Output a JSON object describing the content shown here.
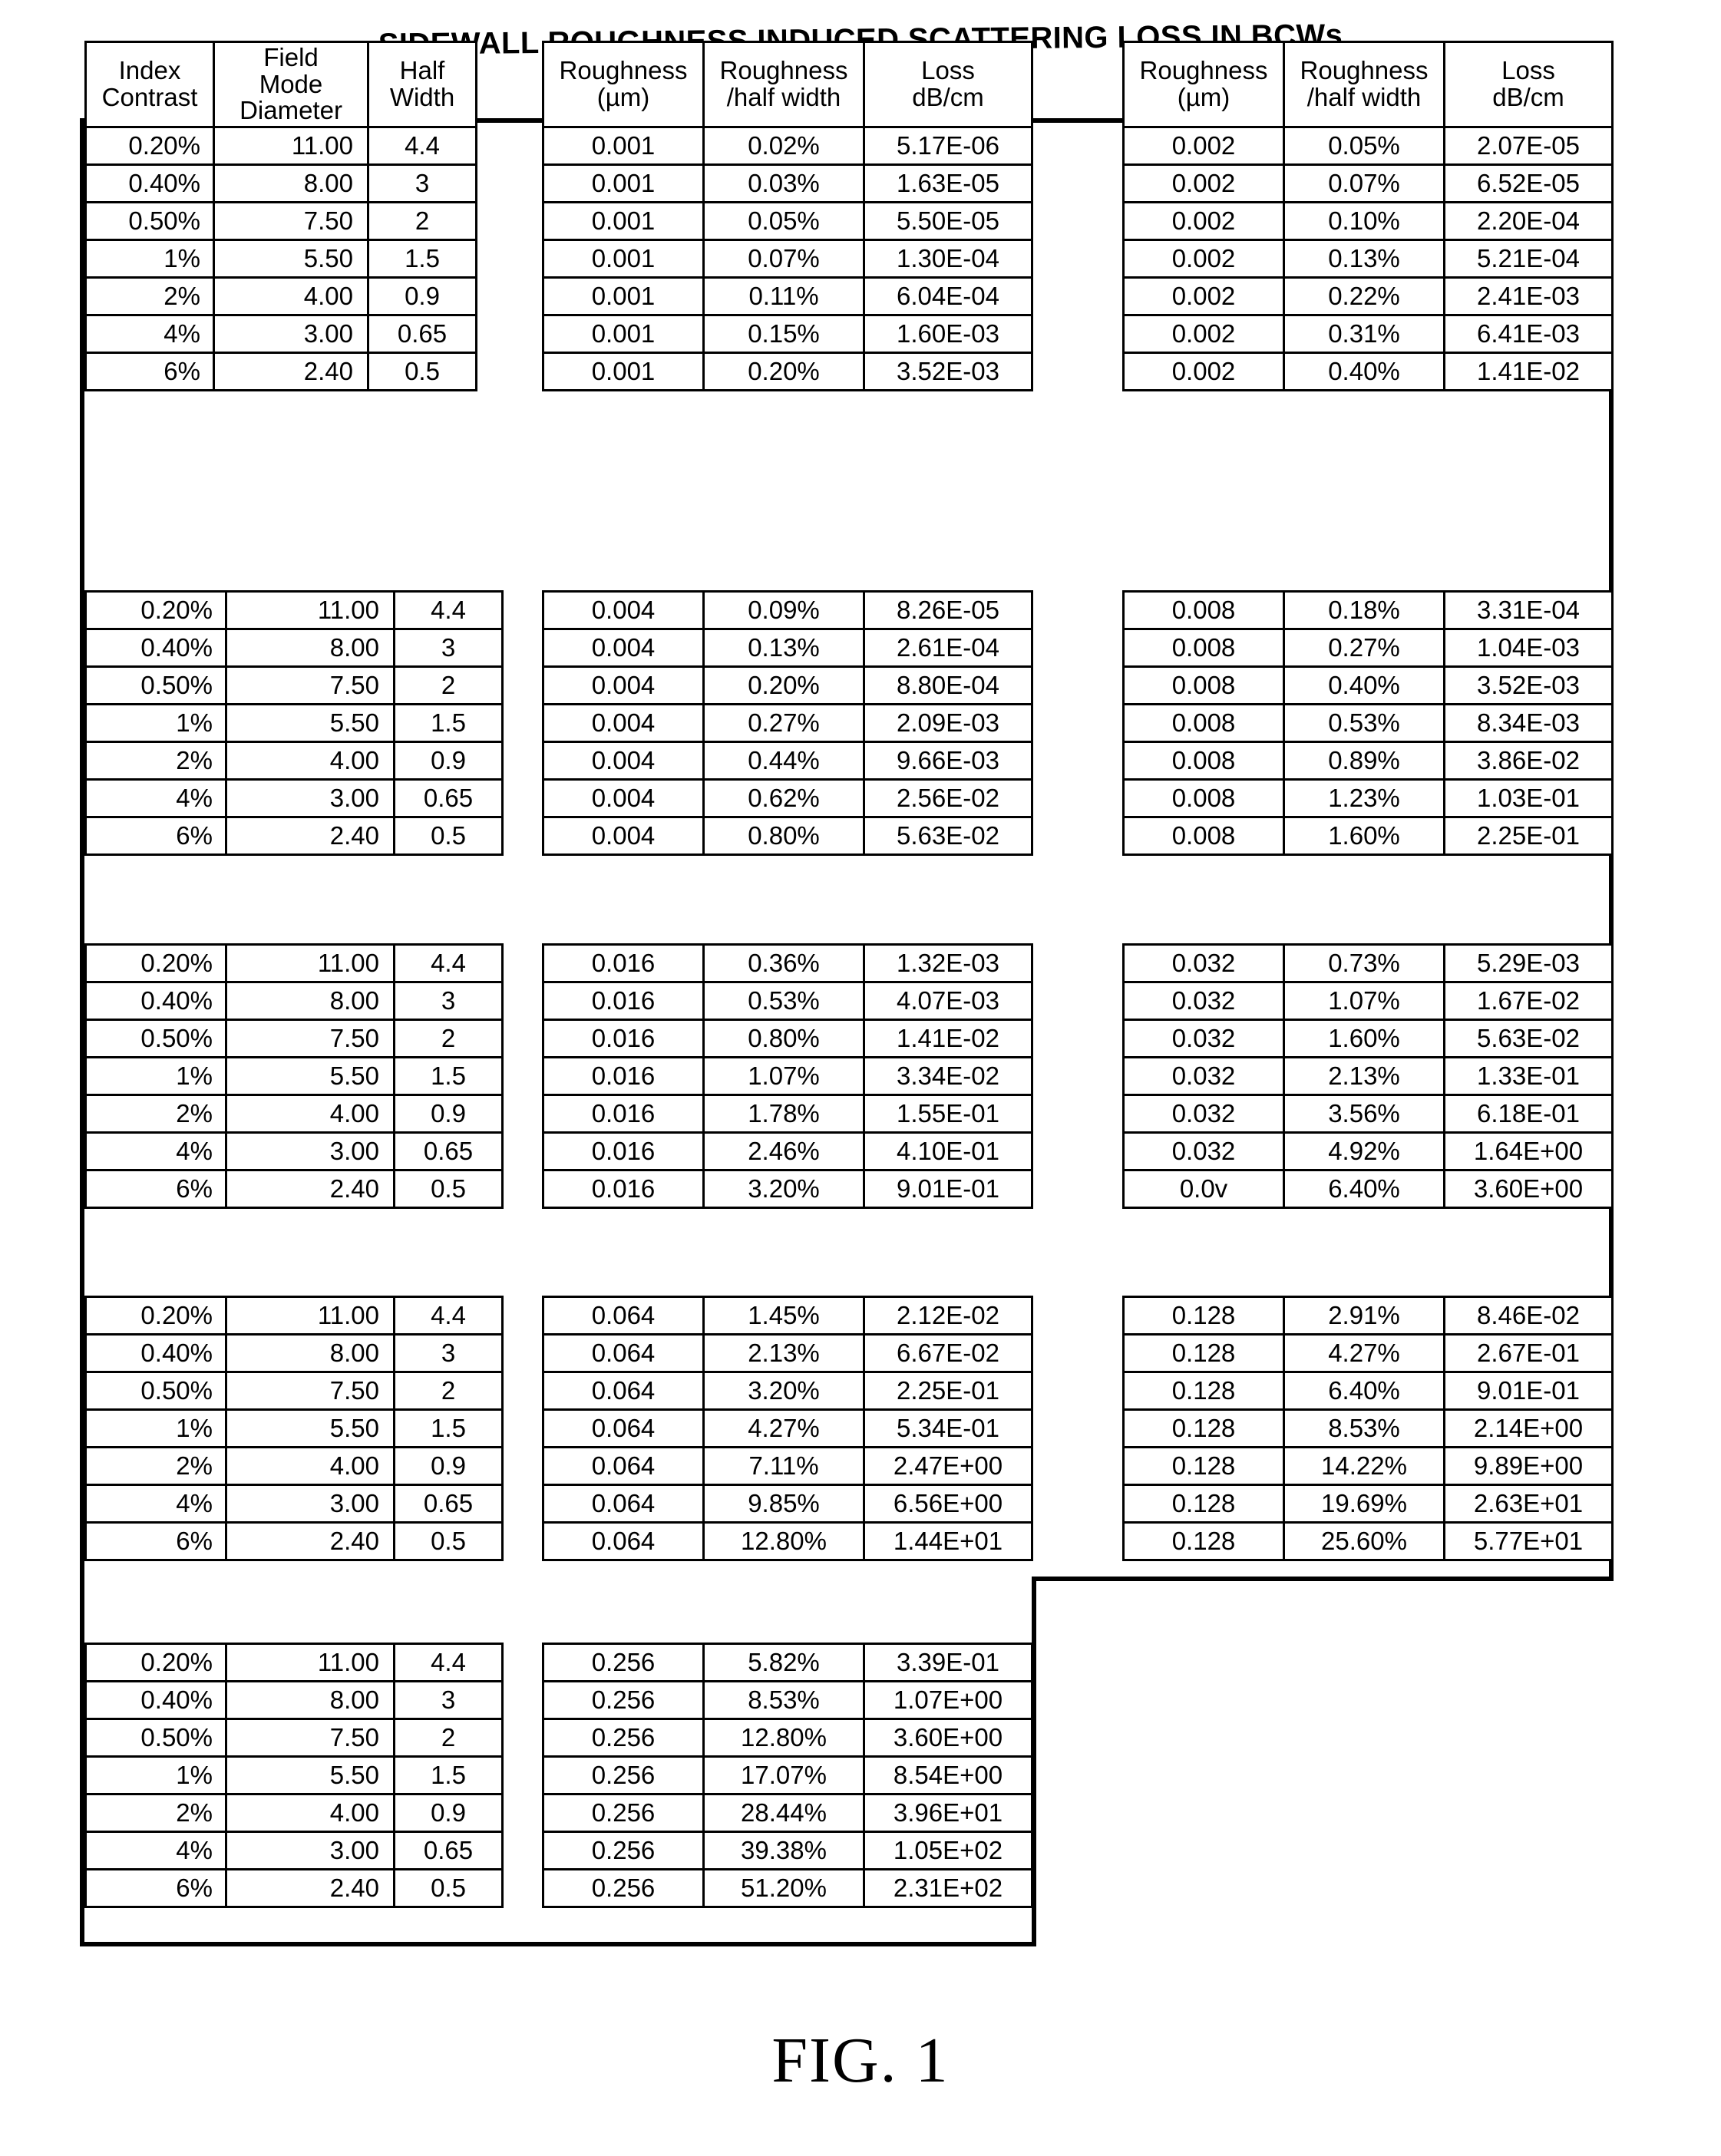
{
  "title": "SIDEWALL ROUGHNESS INDUCED SCATTERING LOSS IN BCWs",
  "figure_caption": "FIG. 1",
  "headers": {
    "index_contrast_l1": "Index",
    "index_contrast_l2": "Contrast",
    "field_mode_l1": "Field",
    "field_mode_l2": "Mode",
    "field_mode_l3": "Diameter",
    "half_width_l1": "Half",
    "half_width_l2": "Width",
    "roughness_l1": "Roughness",
    "roughness_l2": "(µm)",
    "roughness_ratio_l1": "Roughness",
    "roughness_ratio_l2": "/half width",
    "loss_l1": "Loss",
    "loss_l2": "dB/cm"
  },
  "waveguide_rows": [
    {
      "index_contrast": "0.20%",
      "field_mode_diameter": "11.00",
      "half_width": "4.4"
    },
    {
      "index_contrast": "0.40%",
      "field_mode_diameter": "8.00",
      "half_width": "3"
    },
    {
      "index_contrast": "0.50%",
      "field_mode_diameter": "7.50",
      "half_width": "2"
    },
    {
      "index_contrast": "1%",
      "field_mode_diameter": "5.50",
      "half_width": "1.5"
    },
    {
      "index_contrast": "2%",
      "field_mode_diameter": "4.00",
      "half_width": "0.9"
    },
    {
      "index_contrast": "4%",
      "field_mode_diameter": "3.00",
      "half_width": "0.65"
    },
    {
      "index_contrast": "6%",
      "field_mode_diameter": "2.40",
      "half_width": "0.5"
    }
  ],
  "blocks": [
    {
      "middle": [
        {
          "roughness": "0.001",
          "ratio": "0.02%",
          "loss": "5.17E-06"
        },
        {
          "roughness": "0.001",
          "ratio": "0.03%",
          "loss": "1.63E-05"
        },
        {
          "roughness": "0.001",
          "ratio": "0.05%",
          "loss": "5.50E-05"
        },
        {
          "roughness": "0.001",
          "ratio": "0.07%",
          "loss": "1.30E-04"
        },
        {
          "roughness": "0.001",
          "ratio": "0.11%",
          "loss": "6.04E-04"
        },
        {
          "roughness": "0.001",
          "ratio": "0.15%",
          "loss": "1.60E-03"
        },
        {
          "roughness": "0.001",
          "ratio": "0.20%",
          "loss": "3.52E-03"
        }
      ],
      "right": [
        {
          "roughness": "0.002",
          "ratio": "0.05%",
          "loss": "2.07E-05"
        },
        {
          "roughness": "0.002",
          "ratio": "0.07%",
          "loss": "6.52E-05"
        },
        {
          "roughness": "0.002",
          "ratio": "0.10%",
          "loss": "2.20E-04"
        },
        {
          "roughness": "0.002",
          "ratio": "0.13%",
          "loss": "5.21E-04"
        },
        {
          "roughness": "0.002",
          "ratio": "0.22%",
          "loss": "2.41E-03"
        },
        {
          "roughness": "0.002",
          "ratio": "0.31%",
          "loss": "6.41E-03"
        },
        {
          "roughness": "0.002",
          "ratio": "0.40%",
          "loss": "1.41E-02"
        }
      ]
    },
    {
      "middle": [
        {
          "roughness": "0.004",
          "ratio": "0.09%",
          "loss": "8.26E-05"
        },
        {
          "roughness": "0.004",
          "ratio": "0.13%",
          "loss": "2.61E-04"
        },
        {
          "roughness": "0.004",
          "ratio": "0.20%",
          "loss": "8.80E-04"
        },
        {
          "roughness": "0.004",
          "ratio": "0.27%",
          "loss": "2.09E-03"
        },
        {
          "roughness": "0.004",
          "ratio": "0.44%",
          "loss": "9.66E-03"
        },
        {
          "roughness": "0.004",
          "ratio": "0.62%",
          "loss": "2.56E-02"
        },
        {
          "roughness": "0.004",
          "ratio": "0.80%",
          "loss": "5.63E-02"
        }
      ],
      "right": [
        {
          "roughness": "0.008",
          "ratio": "0.18%",
          "loss": "3.31E-04"
        },
        {
          "roughness": "0.008",
          "ratio": "0.27%",
          "loss": "1.04E-03"
        },
        {
          "roughness": "0.008",
          "ratio": "0.40%",
          "loss": "3.52E-03"
        },
        {
          "roughness": "0.008",
          "ratio": "0.53%",
          "loss": "8.34E-03"
        },
        {
          "roughness": "0.008",
          "ratio": "0.89%",
          "loss": "3.86E-02"
        },
        {
          "roughness": "0.008",
          "ratio": "1.23%",
          "loss": "1.03E-01"
        },
        {
          "roughness": "0.008",
          "ratio": "1.60%",
          "loss": "2.25E-01"
        }
      ]
    },
    {
      "middle": [
        {
          "roughness": "0.016",
          "ratio": "0.36%",
          "loss": "1.32E-03"
        },
        {
          "roughness": "0.016",
          "ratio": "0.53%",
          "loss": "4.07E-03"
        },
        {
          "roughness": "0.016",
          "ratio": "0.80%",
          "loss": "1.41E-02"
        },
        {
          "roughness": "0.016",
          "ratio": "1.07%",
          "loss": "3.34E-02"
        },
        {
          "roughness": "0.016",
          "ratio": "1.78%",
          "loss": "1.55E-01"
        },
        {
          "roughness": "0.016",
          "ratio": "2.46%",
          "loss": "4.10E-01"
        },
        {
          "roughness": "0.016",
          "ratio": "3.20%",
          "loss": "9.01E-01"
        }
      ],
      "right": [
        {
          "roughness": "0.032",
          "ratio": "0.73%",
          "loss": "5.29E-03"
        },
        {
          "roughness": "0.032",
          "ratio": "1.07%",
          "loss": "1.67E-02"
        },
        {
          "roughness": "0.032",
          "ratio": "1.60%",
          "loss": "5.63E-02"
        },
        {
          "roughness": "0.032",
          "ratio": "2.13%",
          "loss": "1.33E-01"
        },
        {
          "roughness": "0.032",
          "ratio": "3.56%",
          "loss": "6.18E-01"
        },
        {
          "roughness": "0.032",
          "ratio": "4.92%",
          "loss": "1.64E+00"
        },
        {
          "roughness": "0.0v",
          "ratio": "6.40%",
          "loss": "3.60E+00"
        }
      ]
    },
    {
      "middle": [
        {
          "roughness": "0.064",
          "ratio": "1.45%",
          "loss": "2.12E-02"
        },
        {
          "roughness": "0.064",
          "ratio": "2.13%",
          "loss": "6.67E-02"
        },
        {
          "roughness": "0.064",
          "ratio": "3.20%",
          "loss": "2.25E-01"
        },
        {
          "roughness": "0.064",
          "ratio": "4.27%",
          "loss": "5.34E-01"
        },
        {
          "roughness": "0.064",
          "ratio": "7.11%",
          "loss": "2.47E+00"
        },
        {
          "roughness": "0.064",
          "ratio": "9.85%",
          "loss": "6.56E+00"
        },
        {
          "roughness": "0.064",
          "ratio": "12.80%",
          "loss": "1.44E+01"
        }
      ],
      "right": [
        {
          "roughness": "0.128",
          "ratio": "2.91%",
          "loss": "8.46E-02"
        },
        {
          "roughness": "0.128",
          "ratio": "4.27%",
          "loss": "2.67E-01"
        },
        {
          "roughness": "0.128",
          "ratio": "6.40%",
          "loss": "9.01E-01"
        },
        {
          "roughness": "0.128",
          "ratio": "8.53%",
          "loss": "2.14E+00"
        },
        {
          "roughness": "0.128",
          "ratio": "14.22%",
          "loss": "9.89E+00"
        },
        {
          "roughness": "0.128",
          "ratio": "19.69%",
          "loss": "2.63E+01"
        },
        {
          "roughness": "0.128",
          "ratio": "25.60%",
          "loss": "5.77E+01"
        }
      ]
    },
    {
      "middle": [
        {
          "roughness": "0.256",
          "ratio": "5.82%",
          "loss": "3.39E-01"
        },
        {
          "roughness": "0.256",
          "ratio": "8.53%",
          "loss": "1.07E+00"
        },
        {
          "roughness": "0.256",
          "ratio": "12.80%",
          "loss": "3.60E+00"
        },
        {
          "roughness": "0.256",
          "ratio": "17.07%",
          "loss": "8.54E+00"
        },
        {
          "roughness": "0.256",
          "ratio": "28.44%",
          "loss": "3.96E+01"
        },
        {
          "roughness": "0.256",
          "ratio": "39.38%",
          "loss": "1.05E+02"
        },
        {
          "roughness": "0.256",
          "ratio": "51.20%",
          "loss": "2.31E+02"
        }
      ],
      "right": []
    }
  ]
}
